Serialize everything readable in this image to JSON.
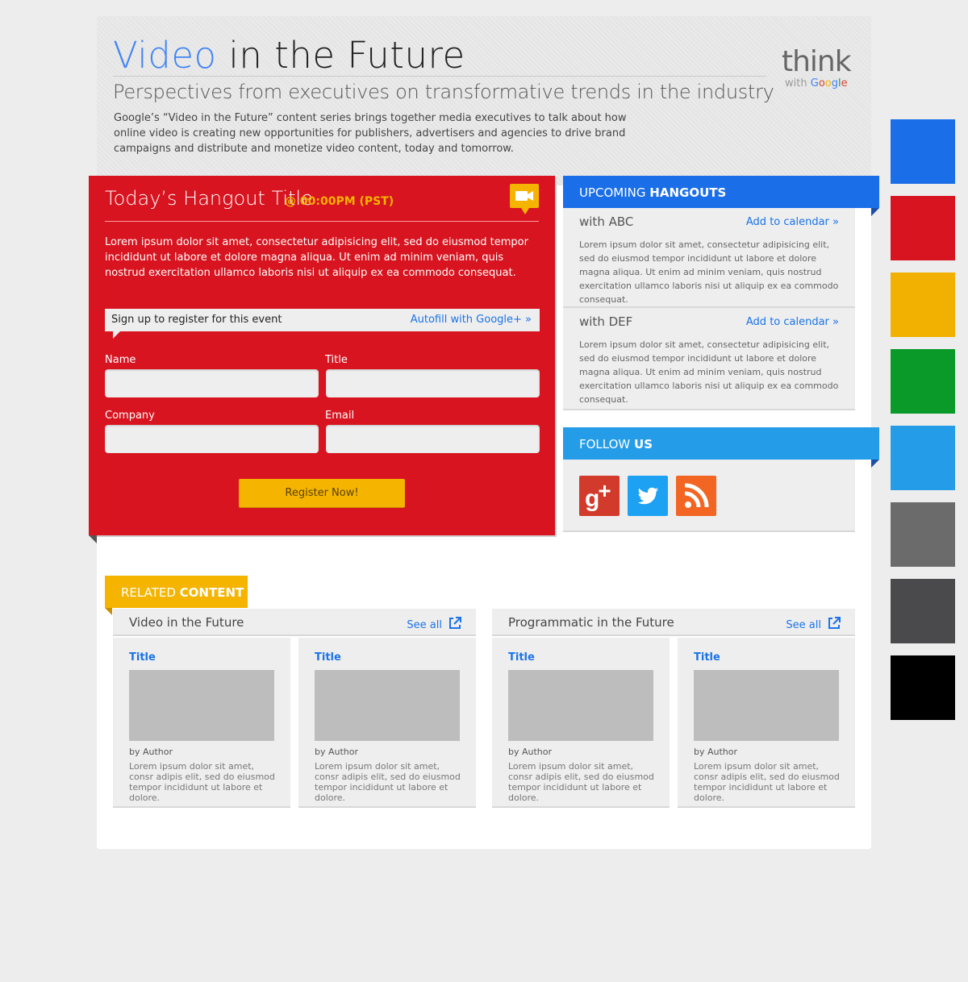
{
  "header": {
    "title_accent": "Video",
    "title_rest": "in the Future",
    "subtitle": "Perspectives from executives on transformative trends in the industry",
    "intro": "Google’s “Video in the Future” content series brings together media executives to talk about how online video is creating new opportunities for publishers, advertisers and agencies to drive brand campaigns and distribute and monetize video content, today and tomorrow.",
    "logo_think": "think",
    "logo_with": "with",
    "logo_google": [
      "G",
      "o",
      "o",
      "g",
      "l",
      "e"
    ]
  },
  "hangout": {
    "title": "Today’s Hangout Title",
    "time": "@ 00:00PM (PST)",
    "icon": "video-camera-icon",
    "description": "Lorem ipsum dolor sit amet, consectetur adipisicing elit, sed do eiusmod tempor incididunt ut labore et dolore magna aliqua. Ut enim ad minim veniam, quis nostrud exercitation ullamco laboris nisi ut aliquip ex ea commodo consequat.",
    "signup_label": "Sign up to register for this event",
    "autofill_label": "Autofill with Google+ »",
    "fields": {
      "name": {
        "label": "Name",
        "value": ""
      },
      "title": {
        "label": "Title",
        "value": ""
      },
      "company": {
        "label": "Company",
        "value": ""
      },
      "email": {
        "label": "Email",
        "value": ""
      }
    },
    "register_label": "Register Now!"
  },
  "upcoming": {
    "heading_light": "UPCOMING",
    "heading_bold": "HANGOUTS",
    "items": [
      {
        "with": "with ABC",
        "add_label": "Add to calendar »",
        "description": "Lorem ipsum dolor sit amet, consectetur adipisicing elit, sed do eiusmod tempor incididunt ut labore et dolore magna aliqua. Ut enim ad minim veniam, quis nostrud exercitation ullamco laboris nisi ut aliquip ex ea commodo consequat."
      },
      {
        "with": "with DEF",
        "add_label": "Add to calendar »",
        "description": "Lorem ipsum dolor sit amet, consectetur adipisicing elit, sed do eiusmod tempor incididunt ut labore et dolore magna aliqua. Ut enim ad minim veniam, quis nostrud exercitation ullamco laboris nisi ut aliquip ex ea commodo consequat."
      }
    ]
  },
  "follow": {
    "heading_light": "FOLLOW",
    "heading_bold": "US",
    "icons": [
      "google-plus-icon",
      "twitter-icon",
      "rss-icon"
    ]
  },
  "related": {
    "heading_light": "RELATED",
    "heading_bold": "CONTENT",
    "groups": [
      {
        "title": "Video in the Future",
        "see_all": "See all",
        "cards": [
          {
            "title": "Title",
            "author": "by Author",
            "description": "Lorem ipsum dolor sit amet, consr adipis elit, sed do eiusmod tempor incididunt ut labore et dolore."
          },
          {
            "title": "Title",
            "author": "by Author",
            "description": "Lorem ipsum dolor sit amet, consr adipis elit, sed do eiusmod tempor incididunt ut labore et dolore."
          }
        ]
      },
      {
        "title": "Programmatic in the Future",
        "see_all": "See all",
        "cards": [
          {
            "title": "Title",
            "author": "by Author",
            "description": "Lorem ipsum dolor sit amet, consr adipis elit, sed do eiusmod tempor incididunt ut labore et dolore."
          },
          {
            "title": "Title",
            "author": "by Author",
            "description": "Lorem ipsum dolor sit amet, consr adipis elit, sed do eiusmod tempor incididunt ut labore et dolore."
          }
        ]
      }
    ]
  },
  "colors": {
    "blue": "#1a73e8",
    "red": "#d7141f",
    "yellow": "#f4b400",
    "green": "#0f9d20",
    "light_blue": "#249ce8",
    "gray": "#6b6b6b",
    "dark_gray": "#4a4a4c",
    "black": "#000000"
  },
  "swatches": [
    "#1a6ee8",
    "#d7141f",
    "#f2b000",
    "#0a9a2a",
    "#249ce8",
    "#6b6b6b",
    "#4a4a4c",
    "#000000"
  ]
}
